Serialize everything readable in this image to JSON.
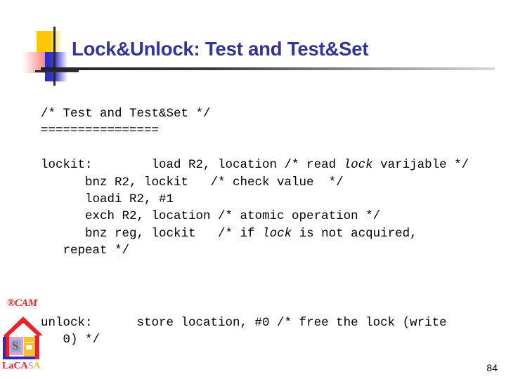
{
  "slide": {
    "title": "Lock&Unlock: Test and Test&Set",
    "page_number": "84",
    "title_color": "#333399"
  },
  "code": {
    "block1": {
      "line1": "/* Test and Test&Set */",
      "line2": "================",
      "line3_pre": "lockit:        load R2, location /* read ",
      "line3_ital": "lock",
      "line3_post": " varijable */",
      "line4": "      bnz R2, lockit   /* check value  */",
      "line5": "      loadi R2, #1",
      "line6": "      exch R2, location /* atomic operation */",
      "line7_pre": "      bnz reg, lockit   /* if ",
      "line7_ital": "lock",
      "line7_post": " is not acquired,",
      "line8": "   repeat */"
    },
    "block2": {
      "line1": "unlock:      store location, #0 /* free the lock (write",
      "line2": "   0) */"
    }
  },
  "brand": {
    "cam_label": "CAM",
    "cam_mark": "®",
    "house_letter": "S",
    "lacasa": {
      "la": "La",
      "ca": "CA",
      "s": "S",
      "a": "A"
    }
  }
}
